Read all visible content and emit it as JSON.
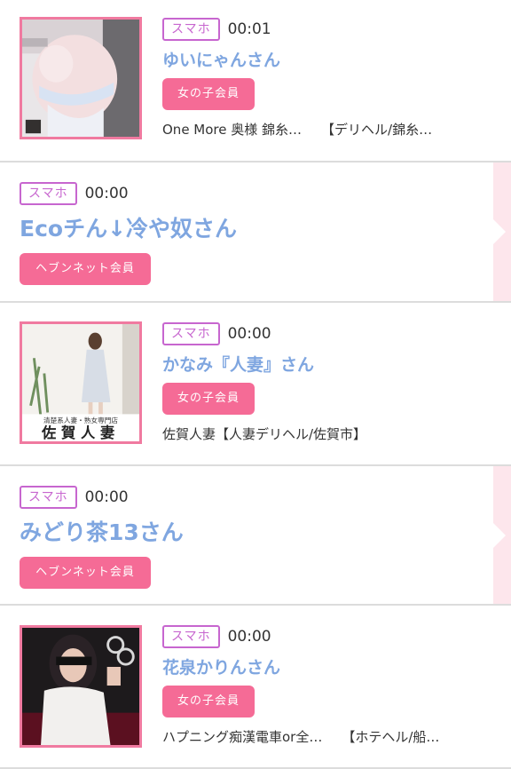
{
  "entries": [
    {
      "kind": "girl",
      "device": "スマホ",
      "time": "00:01",
      "name": "ゆいにゃんさん",
      "type": "女の子会員",
      "shop_name": "One More 奥様 錦糸…",
      "shop_category": "【デリヘル/錦糸…",
      "thumb_icon": "photo-lingerie"
    },
    {
      "kind": "member",
      "device": "スマホ",
      "time": "00:00",
      "name": "Ecoチん↓冷や奴さん",
      "type": "ヘブンネット会員"
    },
    {
      "kind": "girl",
      "device": "スマホ",
      "time": "00:00",
      "name": "かなみ『人妻』さん",
      "type": "女の子会員",
      "shop_name": "佐賀人妻【人妻デリヘル/佐賀市】",
      "shop_category": "",
      "thumb_icon": "photo-dress",
      "thumb_caption_small": "清楚系人妻・熟女専門店",
      "thumb_caption_large": "佐賀人妻"
    },
    {
      "kind": "member",
      "device": "スマホ",
      "time": "00:00",
      "name": "みどり茶13さん",
      "type": "ヘブンネット会員"
    },
    {
      "kind": "girl",
      "device": "スマホ",
      "time": "00:00",
      "name": "花泉かりんさん",
      "type": "女の子会員",
      "shop_name": "ハプニング痴漢電車or全…",
      "shop_category": "【ホテヘル/船…",
      "thumb_icon": "photo-blindfold"
    }
  ],
  "colors": {
    "device_badge": "#c766cf",
    "type_badge": "#f56b96",
    "name": "#7fa6e0",
    "thumb_border": "#f07aa0"
  }
}
